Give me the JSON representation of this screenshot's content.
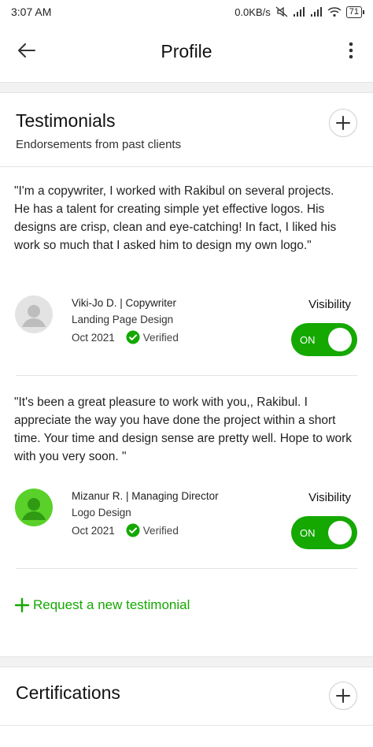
{
  "status_bar": {
    "time": "3:07 AM",
    "net_speed": "0.0KB/s",
    "battery": "71"
  },
  "app_bar": {
    "title": "Profile"
  },
  "testimonials": {
    "title": "Testimonials",
    "subtitle": "Endorsements from past clients",
    "items": [
      {
        "quote": "\"I'm a copywriter, I worked with Rakibul on several projects. He has a talent for creating simple yet effective logos. His designs are crisp, clean and eye-catching! In fact, I liked his work so much that I asked him to design my own logo.\"",
        "name": "Viki-Jo D. | Copywriter",
        "project": "Landing Page Design",
        "date": "Oct 2021",
        "verified": "Verified",
        "visibility_label": "Visibility",
        "toggle": "ON",
        "avatar_color": "#e0e0e0"
      },
      {
        "quote": "\"It's been a great pleasure to work with you,, Rakibul. I appreciate the way you have done the project within a short time. Your time and design sense are pretty well. Hope to work with you very soon. \"",
        "name": "Mizanur R. | Managing Director",
        "project": "Logo Design",
        "date": "Oct 2021",
        "verified": "Verified",
        "visibility_label": "Visibility",
        "toggle": "ON",
        "avatar_color": "#5ad12a"
      }
    ],
    "request_link": "Request a new testimonial"
  },
  "certifications": {
    "title": "Certifications"
  },
  "colors": {
    "accent": "#14a800"
  }
}
